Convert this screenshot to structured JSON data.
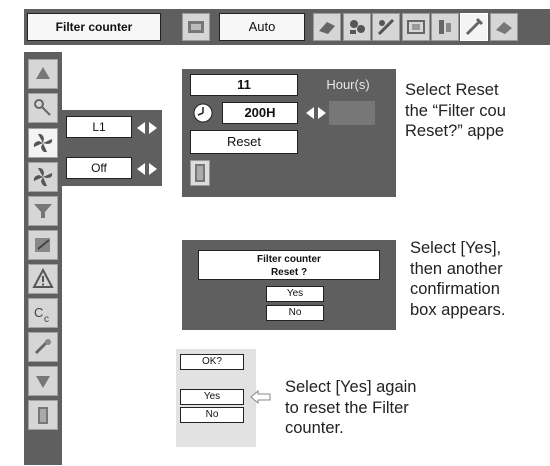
{
  "menu_bar": {
    "title": "Filter counter",
    "input_mode": "Auto"
  },
  "sidebar": {
    "lamp_mode_value": "L1",
    "fan_value": "Off"
  },
  "filter_panel": {
    "hours_value": "11",
    "hours_unit": "Hour(s)",
    "timer_value": "200H",
    "reset_label": "Reset"
  },
  "reset_confirm": {
    "title_line1": "Filter counter",
    "title_line2": "Reset ?",
    "yes_label": "Yes",
    "no_label": "No"
  },
  "final_confirm": {
    "ok_label": "OK?",
    "yes_label": "Yes",
    "no_label": "No"
  },
  "captions": {
    "step1_line1": "Select Reset",
    "step1_line2": "the “Filter cou",
    "step1_line3": "Reset?” appe",
    "step2_line1": "Select [Yes],",
    "step2_line2": "then another",
    "step2_line3": "confirmation",
    "step2_line4": "box appears.",
    "step3_line1": "Select [Yes] again",
    "step3_line2": "to reset the Filter",
    "step3_line3": "counter."
  },
  "colors": {
    "panel_gray": "#5f5f5f",
    "icon_gray": "#d6d6d6",
    "highlight": "#f4f4f4"
  }
}
